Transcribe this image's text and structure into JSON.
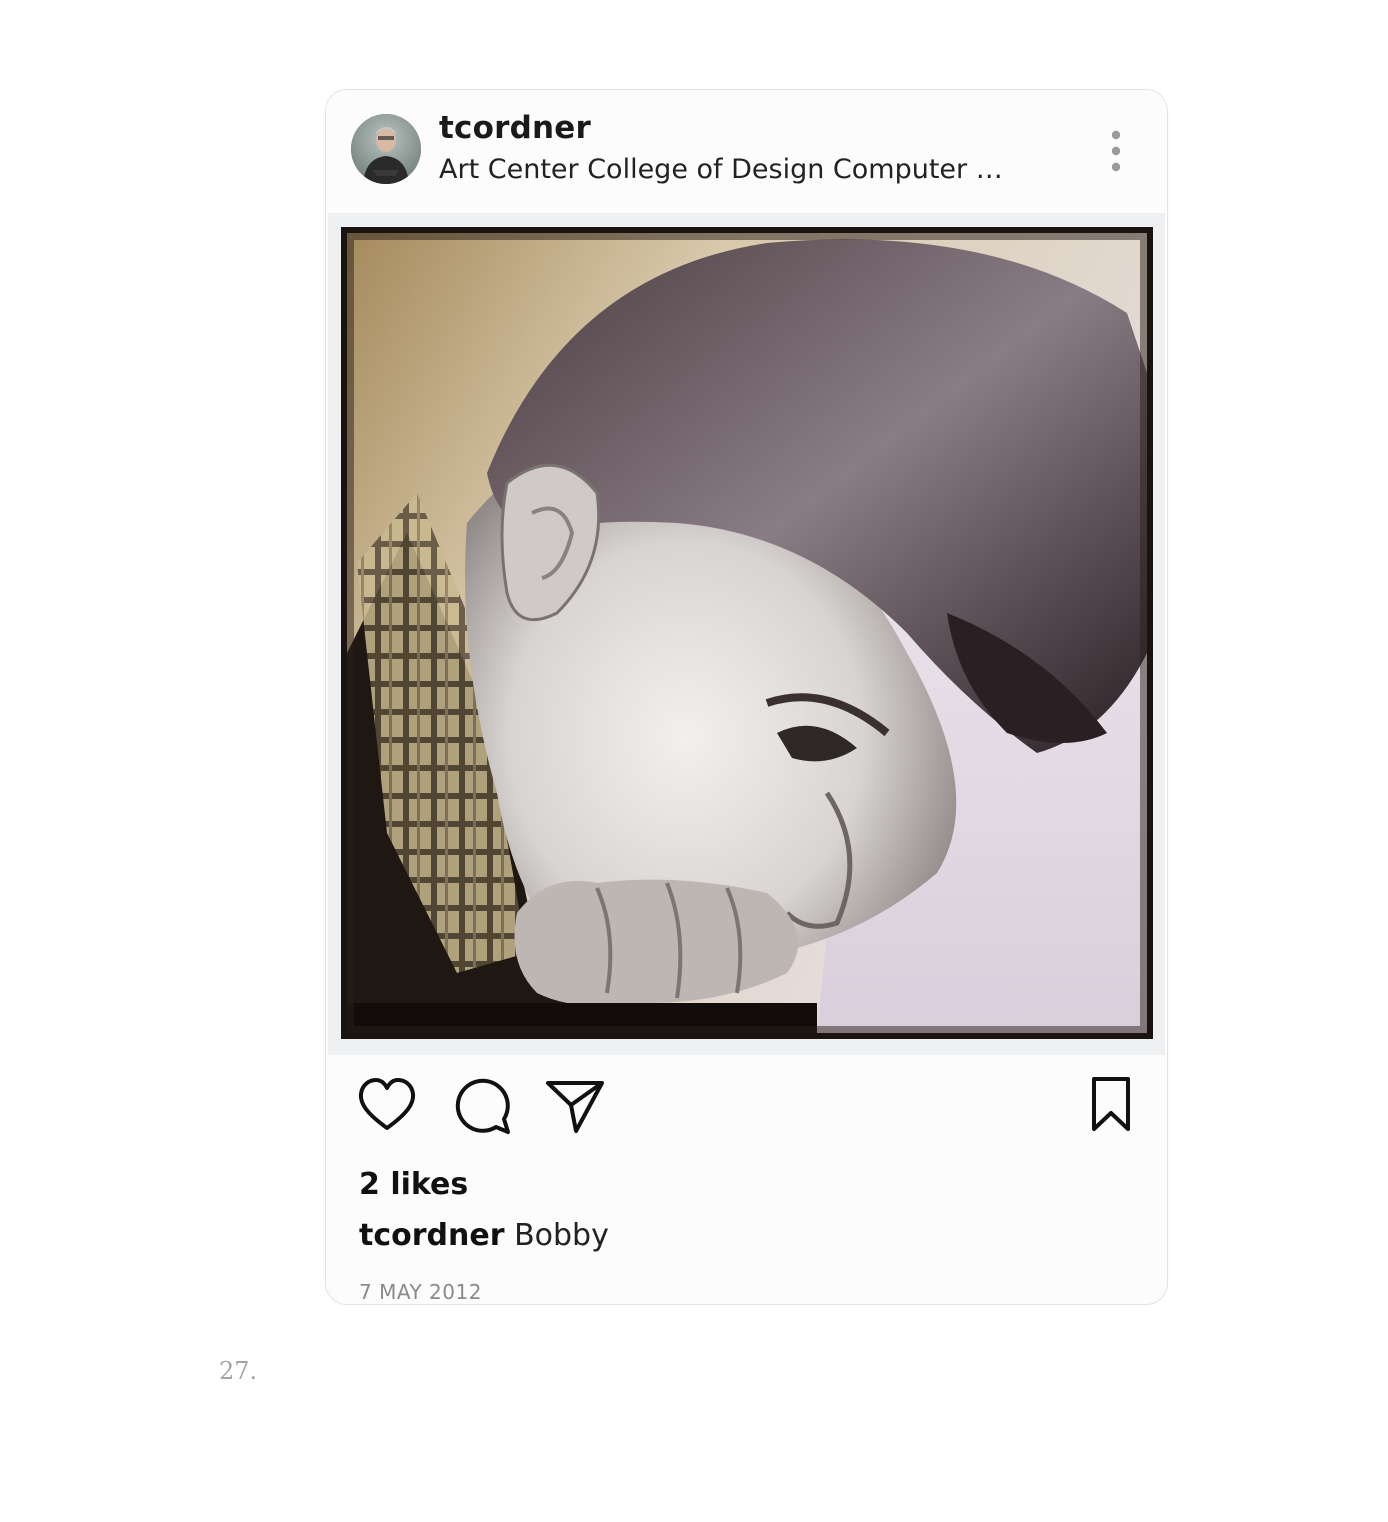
{
  "post": {
    "username": "tcordner",
    "location": "Art Center College of Design Computer …",
    "likes": "2 likes",
    "caption_user": "tcordner",
    "caption_text": "Bobby",
    "date": "7 MAY 2012"
  },
  "icons": {
    "more": "more-vertical-icon",
    "like": "heart-icon",
    "comment": "comment-icon",
    "share": "send-icon",
    "save": "bookmark-icon"
  },
  "page": {
    "number": "27."
  },
  "colors": {
    "card_background": "#fcfcfd",
    "icon_stroke": "#111111",
    "date_text": "#8a8a8a",
    "page_number": "#a4a4a4"
  }
}
